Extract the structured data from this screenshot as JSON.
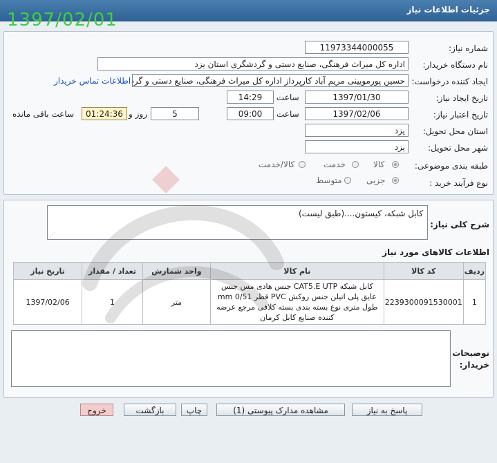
{
  "window": {
    "title": "جزئیات اطلاعات نیاز"
  },
  "overlay_date": "1397/02/01",
  "fields": {
    "need_number_label": "شماره نیاز:",
    "need_number": "11973344000055",
    "buyer_org_label": "نام دستگاه خریدار:",
    "buyer_org": "اداره کل میراث فرهنگی، صنایع دستی و گردشگری استان یزد",
    "requester_label": "ایجاد کننده درخواست:",
    "requester": "حسین پورمویینی مریم آباد کارپرداز اداره کل میراث فرهنگی، صنایع دستی و گردشگری",
    "buyer_contact_link": "اطلاعات تماس خریدار",
    "creation_date_label": "تاریخ ایجاد نیاز:",
    "creation_date": "1397/01/30",
    "time_label": "ساعت",
    "creation_time": "14:29",
    "validity_date_label": "تاریخ اعتبار نیاز:",
    "validity_date": "1397/02/06",
    "validity_time": "09:00",
    "days_value": "5",
    "days_label": "روز و",
    "remaining_time": "01:24:36",
    "remaining_label": "ساعت باقی مانده",
    "province_label": "استان محل تحویل:",
    "province": "یزد",
    "city_label": "شهر محل تحویل:",
    "city": "یزد",
    "category_label": "طبقه بندی موضوعی:",
    "category_options": [
      "کالا",
      "خدمت",
      "کالا/خدمت"
    ],
    "category_selected": "کالا",
    "process_label": "نوع فرآیند خرید :",
    "process_options": [
      "جزیی",
      "متوسط"
    ],
    "process_selected": "جزیی"
  },
  "description": {
    "label": "شرح کلی نیاز:",
    "text": "کابل شبکه، کیستون....(طبق لیست)"
  },
  "items_section": {
    "title": "اطلاعات کالاهای مورد نیاز",
    "columns": [
      "ردیف",
      "کد کالا",
      "نام کالا",
      "واحد شمارش",
      "تعداد / مقدار",
      "تاریخ نیاز"
    ],
    "rows": [
      {
        "row": "1",
        "code": "2239300091530001",
        "name": "کابل شبکه CAT5.E UTP جنس هادی مس جنس عایق پلی اتیلن جنس روکش PVC قطر 0/51 mm طول متری نوع بسته بندی بسته کلافی مرجع عرضه کننده صنایع کابل کرمان",
        "unit": "متر",
        "qty": "1",
        "date": "1397/02/06"
      }
    ]
  },
  "buyer_notes": {
    "label": "توضیحات خریدار:"
  },
  "buttons": {
    "reply": "پاسخ به نیاز",
    "attachments": "مشاهده مدارک پیوستی (1)",
    "print": "چاپ",
    "back": "بازگشت",
    "exit": "خروج"
  },
  "colors": {
    "title_bar": "#2f6296",
    "overlay_date": "#3fcf3f",
    "remaining_box": "#fff5c8",
    "link": "#1a4fc9",
    "exit_button": "#f4cccc"
  }
}
